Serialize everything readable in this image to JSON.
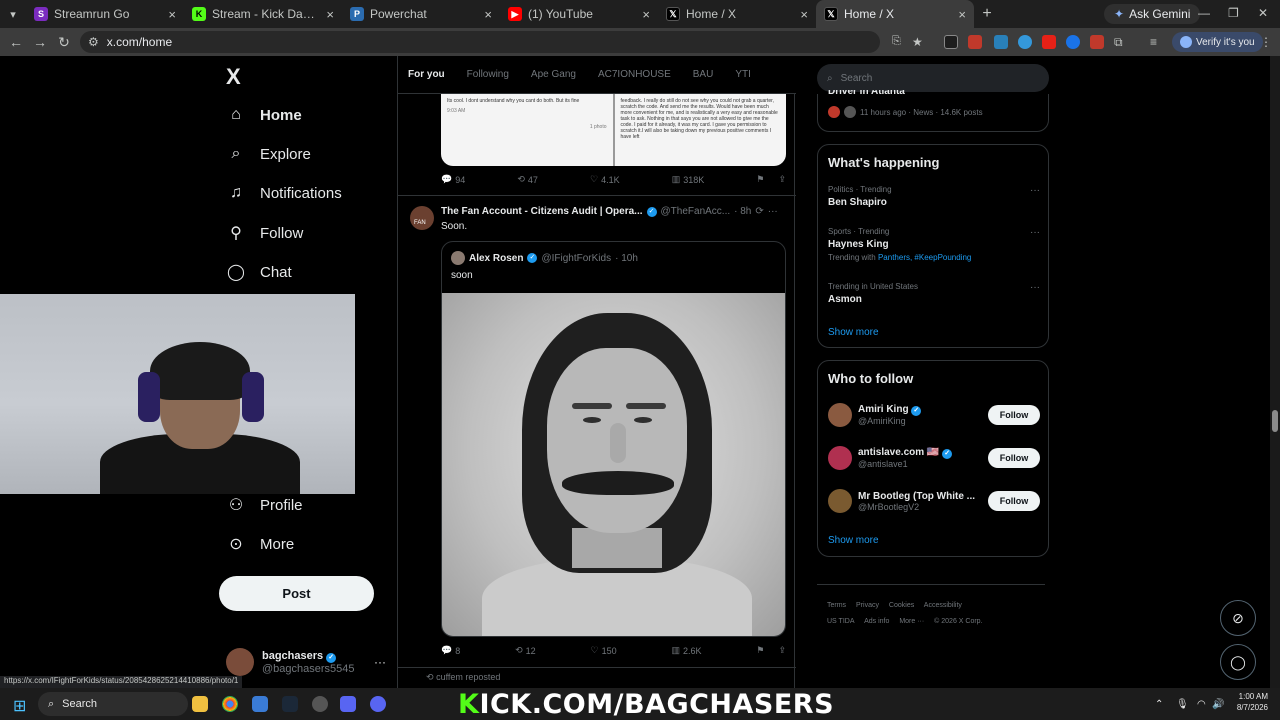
{
  "browser": {
    "tabs": [
      {
        "label": "Streamrun Go",
        "favicon_color": "#7b2cbf",
        "fav_glyph": "S"
      },
      {
        "label": "Stream - Kick Dashboard",
        "favicon_color": "#53fc18",
        "fav_glyph": "K"
      },
      {
        "label": "Powerchat",
        "favicon_color": "#2b6cb0",
        "fav_glyph": "P"
      },
      {
        "label": "(1) YouTube",
        "favicon_color": "#ff0000",
        "fav_glyph": "▶"
      },
      {
        "label": "Home / X",
        "favicon_color": "#000000",
        "fav_glyph": "𝕏"
      },
      {
        "label": "Home / X",
        "favicon_color": "#000000",
        "fav_glyph": "𝕏",
        "active": true
      }
    ],
    "ask_gemini": "Ask Gemini",
    "url": "x.com/home",
    "verify_label": "Verify it's you",
    "status_url": "https://x.com/IFightForKids/status/2085428625214410886/photo/1"
  },
  "sidebar": {
    "logo": "X",
    "items": [
      {
        "label": "Home",
        "icon": "home-icon"
      },
      {
        "label": "Explore",
        "icon": "search-icon"
      },
      {
        "label": "Notifications",
        "icon": "bell-icon"
      },
      {
        "label": "Follow",
        "icon": "person-add-icon"
      },
      {
        "label": "Chat",
        "icon": "chat-icon"
      },
      {
        "label": "Profile",
        "icon": "person-icon"
      },
      {
        "label": "More",
        "icon": "more-circle-icon"
      }
    ],
    "post_label": "Post",
    "account": {
      "name": "bagchasers",
      "handle": "@bagchasers5545"
    }
  },
  "feed": {
    "tabs": [
      "For you",
      "Following",
      "Ape Gang",
      "AC7IONHOUSE",
      "BAU",
      "YTI"
    ],
    "post1": {
      "image_left_text": "Its cool. I dont understand why you cant do both. But its fine",
      "image_right_text": "feedback. I really do still do not see why you could not grab a quarter, scratch the code. And send me the results. Would have been much more convenient for me, and is realistically a very easy and reasonable task to ask. Nothing in that says you are not allowed to give me the code. I paid for it already, it was my card. I gave you permission to scratch it.I will also be taking down my previous positive comments I have left",
      "image_time": "9:03 AM",
      "image_caption": "1 photo",
      "replies": "94",
      "reposts": "47",
      "likes": "4.1K",
      "views": "318K"
    },
    "post2": {
      "name": "The Fan Account - Citizens Audit | Opera...",
      "handle": "@TheFanAcc...",
      "time": "· 8h",
      "avatar_label": "FAN",
      "text": "Soon.",
      "quote": {
        "name": "Alex Rosen",
        "handle": "@IFightForKids",
        "time": "· 10h",
        "text": "soon"
      },
      "replies": "8",
      "reposts": "12",
      "likes": "150",
      "views": "2.6K"
    },
    "repost_notice": "cuffem reposted"
  },
  "right": {
    "search_placeholder": "Search",
    "top_trend": {
      "title": "Driver in Atlanta",
      "meta": "11 hours ago · News · 14.6K posts"
    },
    "whats_happening": "What's happening",
    "trends": [
      {
        "meta": "Politics · Trending",
        "title": "Ben Shapiro"
      },
      {
        "meta": "Sports · Trending",
        "title": "Haynes King",
        "with_prefix": "Trending with",
        "with_links": "Panthers, #KeepPounding"
      },
      {
        "meta": "Trending in United States",
        "title": "Asmon"
      }
    ],
    "show_more": "Show more",
    "who_to_follow": "Who to follow",
    "follow_suggestions": [
      {
        "name": "Amiri King",
        "handle": "@AmiriKing",
        "avatar_color": "#8a5a40"
      },
      {
        "name": "antislave.com 🇺🇸",
        "handle": "@antislave1",
        "avatar_color": "#b03050"
      },
      {
        "name": "Mr Bootleg (Top White ...",
        "handle": "@MrBootlegV2",
        "avatar_color": "#7a5a30"
      }
    ],
    "follow_label": "Follow",
    "footer": [
      "Terms",
      "Privacy",
      "Cookies",
      "Accessibility",
      "US TIDA",
      "Ads info",
      "More ···",
      "© 2026 X Corp."
    ]
  },
  "taskbar": {
    "search_label": "Search",
    "time": "1:00 AM",
    "date": "8/7/2026"
  },
  "overlay": {
    "kick_prefix": "K",
    "kick_rest": "ICK.COM/BAGCHASERS"
  }
}
